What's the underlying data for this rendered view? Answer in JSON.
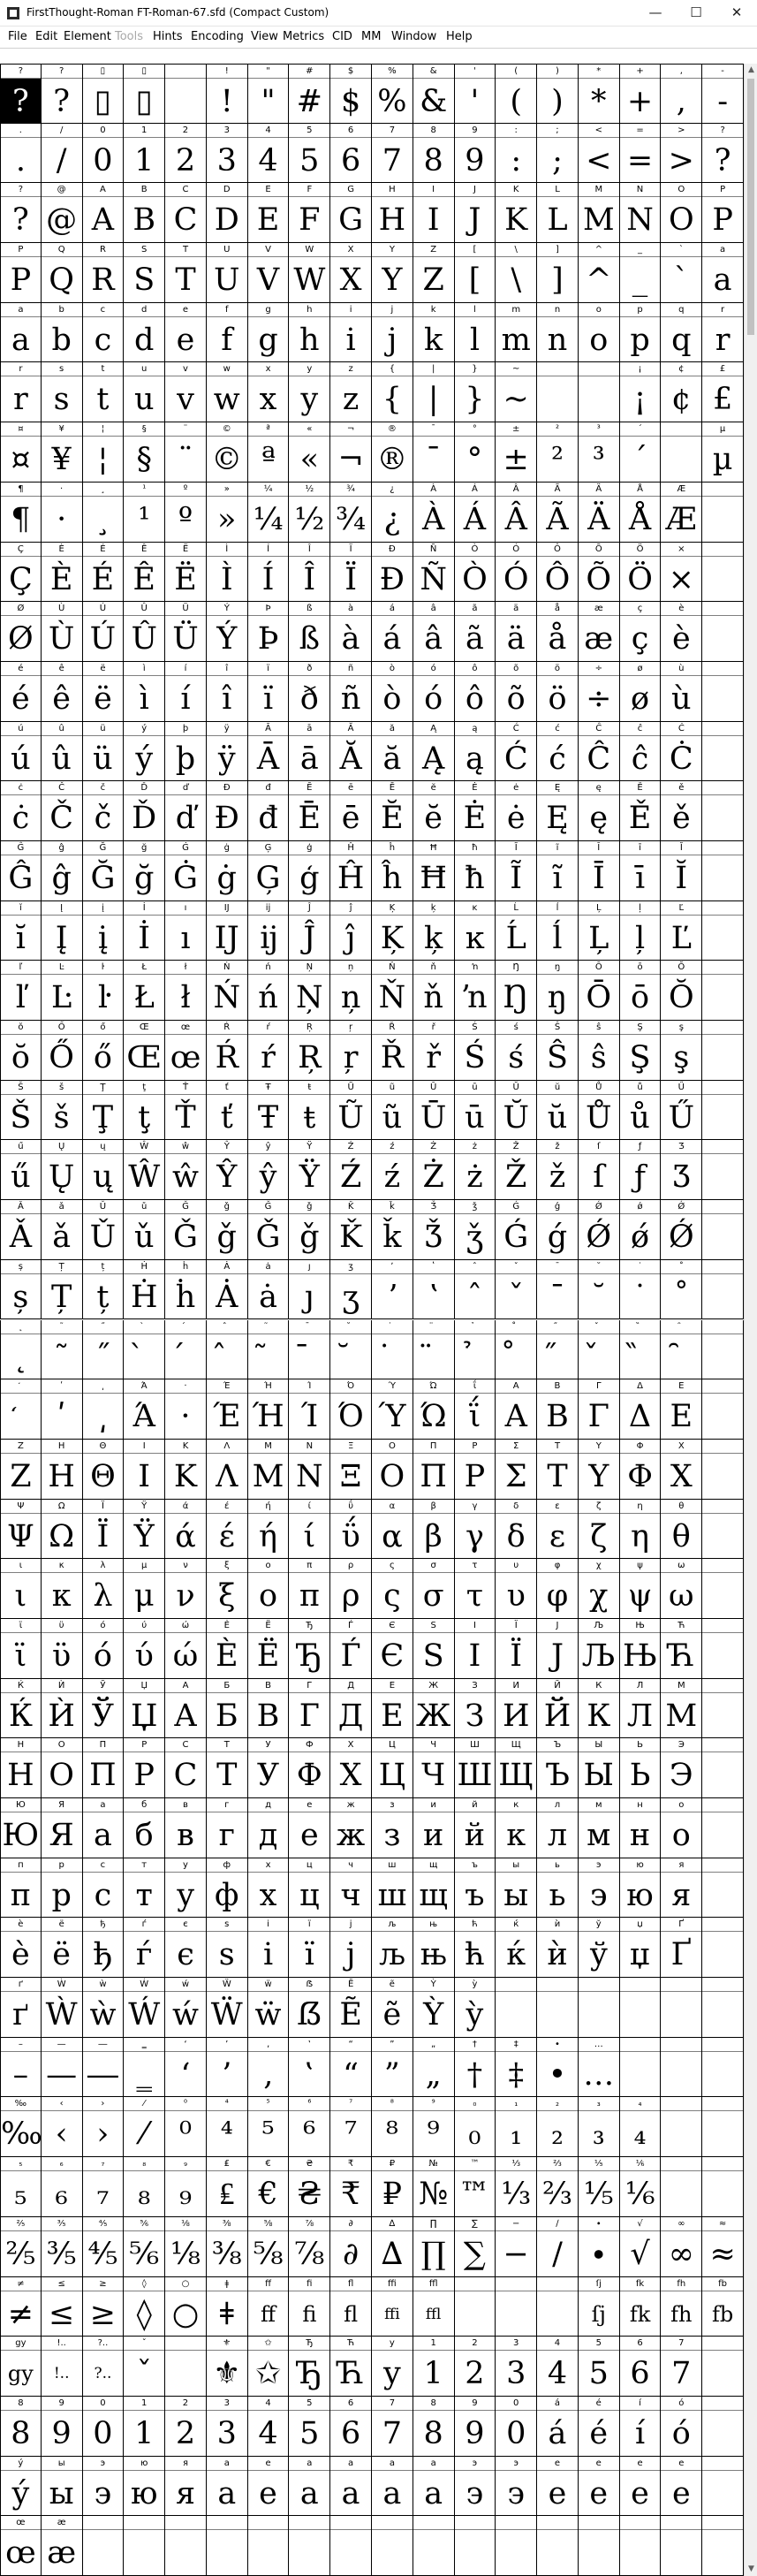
{
  "window": {
    "title": "FirstThought-Roman  FT-Roman-67.sfd (Compact Custom)"
  },
  "controls": {
    "minimize": "—",
    "maximize": "☐",
    "close": "✕"
  },
  "menu": [
    {
      "label": "File",
      "disabled": false
    },
    {
      "label": "Edit",
      "disabled": false
    },
    {
      "label": "Element",
      "disabled": false
    },
    {
      "label": "Tools",
      "disabled": true
    },
    {
      "label": "Hints",
      "disabled": false
    },
    {
      "label": "Encoding",
      "disabled": false
    },
    {
      "label": "View",
      "disabled": false
    },
    {
      "label": "Metrics",
      "disabled": false
    },
    {
      "label": "CID",
      "disabled": false
    },
    {
      "label": "MM",
      "disabled": false
    },
    {
      "label": "Window",
      "disabled": false
    },
    {
      "label": "Help",
      "disabled": false
    }
  ],
  "scrollbar": {
    "up": "▲",
    "down": "▼"
  },
  "grid": {
    "columns": 18,
    "selected_index": 0,
    "missing_label_color": "#d00000",
    "rows": [
      [
        "?",
        "?",
        "▯",
        "▯",
        "",
        "!",
        "\"",
        "#",
        "$",
        "%",
        "&",
        "'",
        "(",
        ")",
        "*",
        "+",
        ",",
        "-"
      ],
      [
        ".",
        "/",
        "0",
        "1",
        "2",
        "3",
        "4",
        "5",
        "6",
        "7",
        "8",
        "9",
        ":",
        ";",
        "<",
        "=",
        ">",
        "?"
      ],
      [
        "?",
        "@",
        "A",
        "B",
        "C",
        "D",
        "E",
        "F",
        "G",
        "H",
        "I",
        "J",
        "K",
        "L",
        "M",
        "N",
        "O",
        "P"
      ],
      [
        "P",
        "Q",
        "R",
        "S",
        "T",
        "U",
        "V",
        "W",
        "X",
        "Y",
        "Z",
        "[",
        "\\",
        "]",
        "^",
        "_",
        "`",
        "a"
      ],
      [
        "a",
        "b",
        "c",
        "d",
        "e",
        "f",
        "g",
        "h",
        "i",
        "j",
        "k",
        "l",
        "m",
        "n",
        "o",
        "p",
        "q",
        "r"
      ],
      [
        "r",
        "s",
        "t",
        "u",
        "v",
        "w",
        "x",
        "y",
        "z",
        "{",
        "|",
        "}",
        "~",
        "",
        "",
        "¡",
        "¢",
        "£"
      ],
      [
        "¤",
        "¥",
        "¦",
        "§",
        "¨",
        "©",
        "ª",
        "«",
        "¬",
        "®",
        "¯",
        "°",
        "±",
        "²",
        "³",
        "´",
        "",
        "µ"
      ],
      [
        "¶",
        "·",
        "¸",
        "¹",
        "º",
        "»",
        "¼",
        "½",
        "¾",
        "¿",
        "À",
        "Á",
        "Â",
        "Ã",
        "Ä",
        "Å",
        "Æ",
        ""
      ],
      [
        "Ç",
        "È",
        "É",
        "Ê",
        "Ë",
        "Ì",
        "Í",
        "Î",
        "Ï",
        "Ð",
        "Ñ",
        "Ò",
        "Ó",
        "Ô",
        "Õ",
        "Ö",
        "×",
        ""
      ],
      [
        "Ø",
        "Ù",
        "Ú",
        "Û",
        "Ü",
        "Ý",
        "Þ",
        "ß",
        "à",
        "á",
        "â",
        "ã",
        "ä",
        "å",
        "æ",
        "ç",
        "è",
        ""
      ],
      [
        "é",
        "ê",
        "ë",
        "ì",
        "í",
        "î",
        "ï",
        "ð",
        "ñ",
        "ò",
        "ó",
        "ô",
        "õ",
        "ö",
        "÷",
        "ø",
        "ù",
        ""
      ],
      [
        "ú",
        "û",
        "ü",
        "ý",
        "þ",
        "ÿ",
        "Ā",
        "ā",
        "Ă",
        "ă",
        "Ą",
        "ą",
        "Ć",
        "ć",
        "Ĉ",
        "ĉ",
        "Ċ",
        ""
      ],
      [
        "ċ",
        "Č",
        "č",
        "Ď",
        "ď",
        "Đ",
        "đ",
        "Ē",
        "ē",
        "Ĕ",
        "ĕ",
        "Ė",
        "ė",
        "Ę",
        "ę",
        "Ě",
        "ě",
        ""
      ],
      [
        "Ĝ",
        "ĝ",
        "Ğ",
        "ğ",
        "Ġ",
        "ġ",
        "Ģ",
        "ģ",
        "Ĥ",
        "ĥ",
        "Ħ",
        "ħ",
        "Ĩ",
        "ĩ",
        "Ī",
        "ī",
        "Ĭ",
        ""
      ],
      [
        "ĭ",
        "Į",
        "į",
        "İ",
        "ı",
        "Ĳ",
        "ĳ",
        "Ĵ",
        "ĵ",
        "Ķ",
        "ķ",
        "ĸ",
        "Ĺ",
        "ĺ",
        "Ļ",
        "ļ",
        "Ľ",
        ""
      ],
      [
        "ľ",
        "Ŀ",
        "ŀ",
        "Ł",
        "ł",
        "Ń",
        "ń",
        "Ņ",
        "ņ",
        "Ň",
        "ň",
        "ŉ",
        "Ŋ",
        "ŋ",
        "Ō",
        "ō",
        "Ŏ",
        ""
      ],
      [
        "ŏ",
        "Ő",
        "ő",
        "Œ",
        "œ",
        "Ŕ",
        "ŕ",
        "Ŗ",
        "ŗ",
        "Ř",
        "ř",
        "Ś",
        "ś",
        "Ŝ",
        "ŝ",
        "Ş",
        "ş",
        ""
      ],
      [
        "Š",
        "š",
        "Ţ",
        "ţ",
        "Ť",
        "ť",
        "Ŧ",
        "ŧ",
        "Ũ",
        "ũ",
        "Ū",
        "ū",
        "Ŭ",
        "ŭ",
        "Ů",
        "ů",
        "Ű",
        ""
      ],
      [
        "ű",
        "Ų",
        "ų",
        "Ŵ",
        "ŵ",
        "Ŷ",
        "ŷ",
        "Ÿ",
        "Ź",
        "ź",
        "Ż",
        "ż",
        "Ž",
        "ž",
        "ſ",
        "ƒ",
        "Ʒ",
        ""
      ],
      [
        "Ǎ",
        "ǎ",
        "Ǔ",
        "ǔ",
        "Ǧ",
        "ǧ",
        "Ǧ",
        "ǧ",
        "Ǩ",
        "ǩ",
        "Ǯ",
        "ǯ",
        "Ǵ",
        "ǵ",
        "Ǿ",
        "ǿ",
        "Ǿ",
        ""
      ],
      [
        "ș",
        "Ț",
        "ț",
        "Ḣ",
        "ḣ",
        "Ȧ",
        "ȧ",
        "ȷ",
        "ʒ",
        "ʼ",
        "ʽ",
        "ˆ",
        "ˇ",
        "ˉ",
        "˘",
        "˙",
        "˚",
        ""
      ],
      [
        "˛",
        "˜",
        "˝",
        "̀",
        "́",
        "̂",
        "̃",
        "̄",
        "̆",
        "̇",
        "̈",
        "̉",
        "̊",
        "̋",
        "̌",
        "̏",
        "̑",
        ""
      ],
      [
        "̒",
        "ʹ",
        "͵",
        "Ά",
        "·",
        "Έ",
        "Ή",
        "Ί",
        "Ό",
        "Ύ",
        "Ώ",
        "ΐ",
        "Α",
        "Β",
        "Γ",
        "Δ",
        "Ε",
        ""
      ],
      [
        "Ζ",
        "Η",
        "Θ",
        "Ι",
        "Κ",
        "Λ",
        "Μ",
        "Ν",
        "Ξ",
        "Ο",
        "Π",
        "Ρ",
        "Σ",
        "Τ",
        "Υ",
        "Φ",
        "Χ",
        ""
      ],
      [
        "Ψ",
        "Ω",
        "Ϊ",
        "Ϋ",
        "ά",
        "έ",
        "ή",
        "ί",
        "ΰ",
        "α",
        "β",
        "γ",
        "δ",
        "ε",
        "ζ",
        "η",
        "θ",
        ""
      ],
      [
        "ι",
        "κ",
        "λ",
        "μ",
        "ν",
        "ξ",
        "ο",
        "π",
        "ρ",
        "ς",
        "σ",
        "τ",
        "υ",
        "φ",
        "χ",
        "ψ",
        "ω",
        ""
      ],
      [
        "ϊ",
        "ϋ",
        "ό",
        "ύ",
        "ώ",
        "Ѐ",
        "Ё",
        "Ђ",
        "Ѓ",
        "Є",
        "Ѕ",
        "І",
        "Ї",
        "Ј",
        "Љ",
        "Њ",
        "Ћ",
        ""
      ],
      [
        "Ќ",
        "Ѝ",
        "Ў",
        "Џ",
        "А",
        "Б",
        "В",
        "Г",
        "Д",
        "Е",
        "Ж",
        "З",
        "И",
        "Й",
        "К",
        "Л",
        "М",
        ""
      ],
      [
        "Н",
        "О",
        "П",
        "Р",
        "С",
        "Т",
        "У",
        "Ф",
        "Х",
        "Ц",
        "Ч",
        "Ш",
        "Щ",
        "Ъ",
        "Ы",
        "Ь",
        "Э",
        ""
      ],
      [
        "Ю",
        "Я",
        "а",
        "б",
        "в",
        "г",
        "д",
        "е",
        "ж",
        "з",
        "и",
        "й",
        "к",
        "л",
        "м",
        "н",
        "о",
        ""
      ],
      [
        "п",
        "р",
        "с",
        "т",
        "у",
        "ф",
        "х",
        "ц",
        "ч",
        "ш",
        "щ",
        "ъ",
        "ы",
        "ь",
        "э",
        "ю",
        "я",
        ""
      ],
      [
        "ѐ",
        "ё",
        "ђ",
        "ѓ",
        "є",
        "ѕ",
        "і",
        "ї",
        "ј",
        "љ",
        "њ",
        "ћ",
        "ќ",
        "ѝ",
        "ў",
        "џ",
        "Ґ",
        ""
      ],
      [
        "ґ",
        "Ẁ",
        "ẁ",
        "Ẃ",
        "ẃ",
        "Ẅ",
        "ẅ",
        "ẞ",
        "Ẽ",
        "ẽ",
        "Ỳ",
        "ỳ",
        "",
        "",
        "",
        "",
        "",
        ""
      ],
      [
        "–",
        "—",
        "―",
        "‗",
        "‘",
        "’",
        "‚",
        "‛",
        "“",
        "”",
        "„",
        "†",
        "‡",
        "•",
        "…",
        "",
        "",
        ""
      ],
      [
        "‰",
        "‹",
        "›",
        "⁄",
        "⁰",
        "⁴",
        "⁵",
        "⁶",
        "⁷",
        "⁸",
        "⁹",
        "₀",
        "₁",
        "₂",
        "₃",
        "₄",
        "",
        ""
      ],
      [
        "₅",
        "₆",
        "₇",
        "₈",
        "₉",
        "₤",
        "€",
        "₴",
        "₹",
        "₽",
        "№",
        "™",
        "⅓",
        "⅔",
        "⅕",
        "⅙",
        "",
        ""
      ],
      [
        "⅖",
        "⅗",
        "⅘",
        "⅚",
        "⅛",
        "⅜",
        "⅝",
        "⅞",
        "∂",
        "∆",
        "∏",
        "∑",
        "−",
        "∕",
        "∙",
        "√",
        "∞",
        "≈"
      ],
      [
        "≠",
        "≤",
        "≥",
        "◊",
        "○",
        "ǂ",
        "ff",
        "fi",
        "fl",
        "ffi",
        "ffl",
        "",
        "",
        "",
        "ſj",
        "fk",
        "fh",
        "fb"
      ],
      [
        "gy",
        "!..",
        "?..",
        "ˇ",
        "",
        "⚜",
        "✩",
        "Ђ",
        "Ћ",
        "y",
        "1",
        "2",
        "3",
        "4",
        "5",
        "6",
        "7",
        ""
      ],
      [
        "8",
        "9",
        "0",
        "1",
        "2",
        "3",
        "4",
        "5",
        "6",
        "7",
        "8",
        "9",
        "0",
        "á",
        "é",
        "í",
        "ó",
        ""
      ],
      [
        "ý",
        "ы",
        "э",
        "ю",
        "я",
        "а",
        "е",
        "а",
        "а",
        "а",
        "а",
        "э",
        "э",
        "е",
        "е",
        "е",
        "е",
        ""
      ],
      [
        "œ",
        "æ",
        "",
        "",
        "",
        "",
        "",
        "",
        "",
        "",
        "",
        "",
        "",
        "",
        "",
        "",
        "",
        ""
      ]
    ]
  }
}
